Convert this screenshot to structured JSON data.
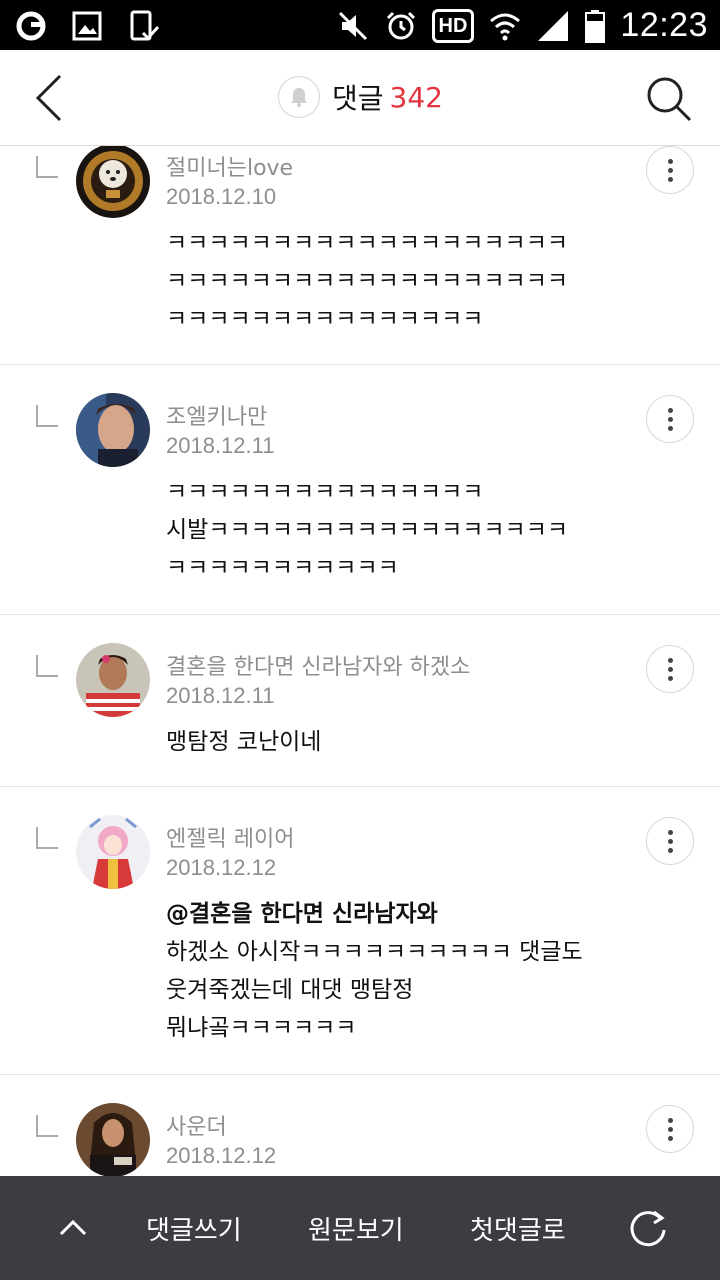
{
  "status_bar": {
    "time": "12:23",
    "left_icons": [
      "olleh-icon",
      "gallery-icon",
      "phone-check-icon"
    ],
    "right_icons": [
      "mute-icon",
      "alarm-icon",
      "hd-icon",
      "wifi-icon",
      "signal-icon",
      "battery-icon"
    ],
    "hd_label": "HD"
  },
  "header": {
    "title": "댓글",
    "count": "342",
    "accent_color": "#e2353f"
  },
  "comments": [
    {
      "name": "절미너는love",
      "date": "2018.12.10",
      "body": "ㅋㅋㅋㅋㅋㅋㅋㅋㅋㅋㅋㅋㅋㅋㅋㅋㅋㅋㅋ\nㅋㅋㅋㅋㅋㅋㅋㅋㅋㅋㅋㅋㅋㅋㅋㅋㅋㅋㅋ\nㅋㅋㅋㅋㅋㅋㅋㅋㅋㅋㅋㅋㅋㅋㅋ"
    },
    {
      "name": "조엘키나만",
      "date": "2018.12.11",
      "body": "ㅋㅋㅋㅋㅋㅋㅋㅋㅋㅋㅋㅋㅋㅋㅋ\n시발ㅋㅋㅋㅋㅋㅋㅋㅋㅋㅋㅋㅋㅋㅋㅋㅋㅋ\nㅋㅋㅋㅋㅋㅋㅋㅋㅋㅋㅋ"
    },
    {
      "name": "결혼을 한다면 신라남자와 하겠소",
      "date": "2018.12.11",
      "body": "맹탐정 코난이네"
    },
    {
      "name": "엔젤릭 레이어",
      "date": "2018.12.12",
      "mention": "@결혼을 한다면 신라남자와",
      "body": "하겠소 아시작ㅋㅋㅋㅋㅋㅋㅋㅋㅋㅋ 댓글도\n웃겨죽겠는데 대댓 맹탐정\n뭐냐곸ㅋㅋㅋㅋㅋㅋ"
    },
    {
      "name": "사운더",
      "date": "2018.12.12",
      "body": ""
    }
  ],
  "bottom_bar": {
    "write_label": "댓글쓰기",
    "original_label": "원문보기",
    "first_label": "첫댓글로"
  }
}
